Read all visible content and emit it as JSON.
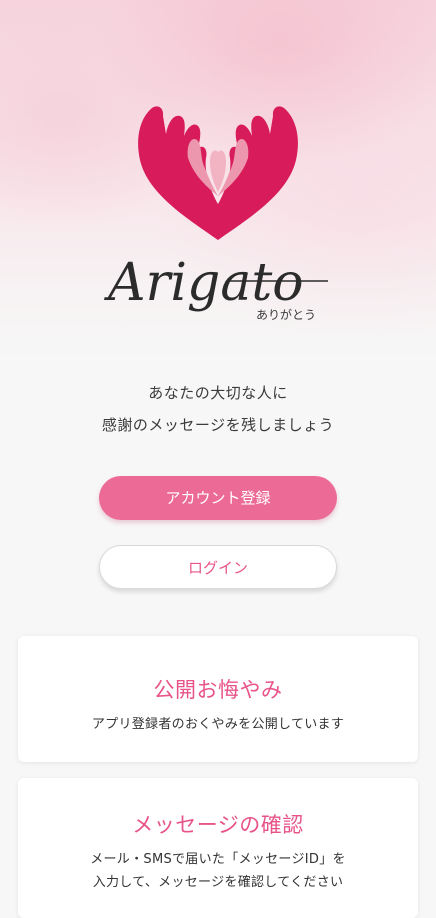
{
  "brand": {
    "name": "Arigato",
    "subtitle": "ありがとう"
  },
  "tagline": {
    "line1": "あなたの大切な人に",
    "line2": "感謝のメッセージを残しましょう"
  },
  "buttons": {
    "register_label": "アカウント登録",
    "login_label": "ログイン"
  },
  "cards": [
    {
      "title": "公開お悔やみ",
      "description_lines": [
        "アプリ登録者のおくやみを公開しています"
      ]
    },
    {
      "title": "メッセージの確認",
      "description_lines": [
        "メール・SMSで届いた「メッセージID」を",
        "入力して、メッセージを確認してください"
      ]
    }
  ],
  "colors": {
    "accent": "#ec6b96",
    "accent_text": "#e8548a",
    "heart_dark": "#d81b5a",
    "heart_light": "#ec97ad"
  }
}
